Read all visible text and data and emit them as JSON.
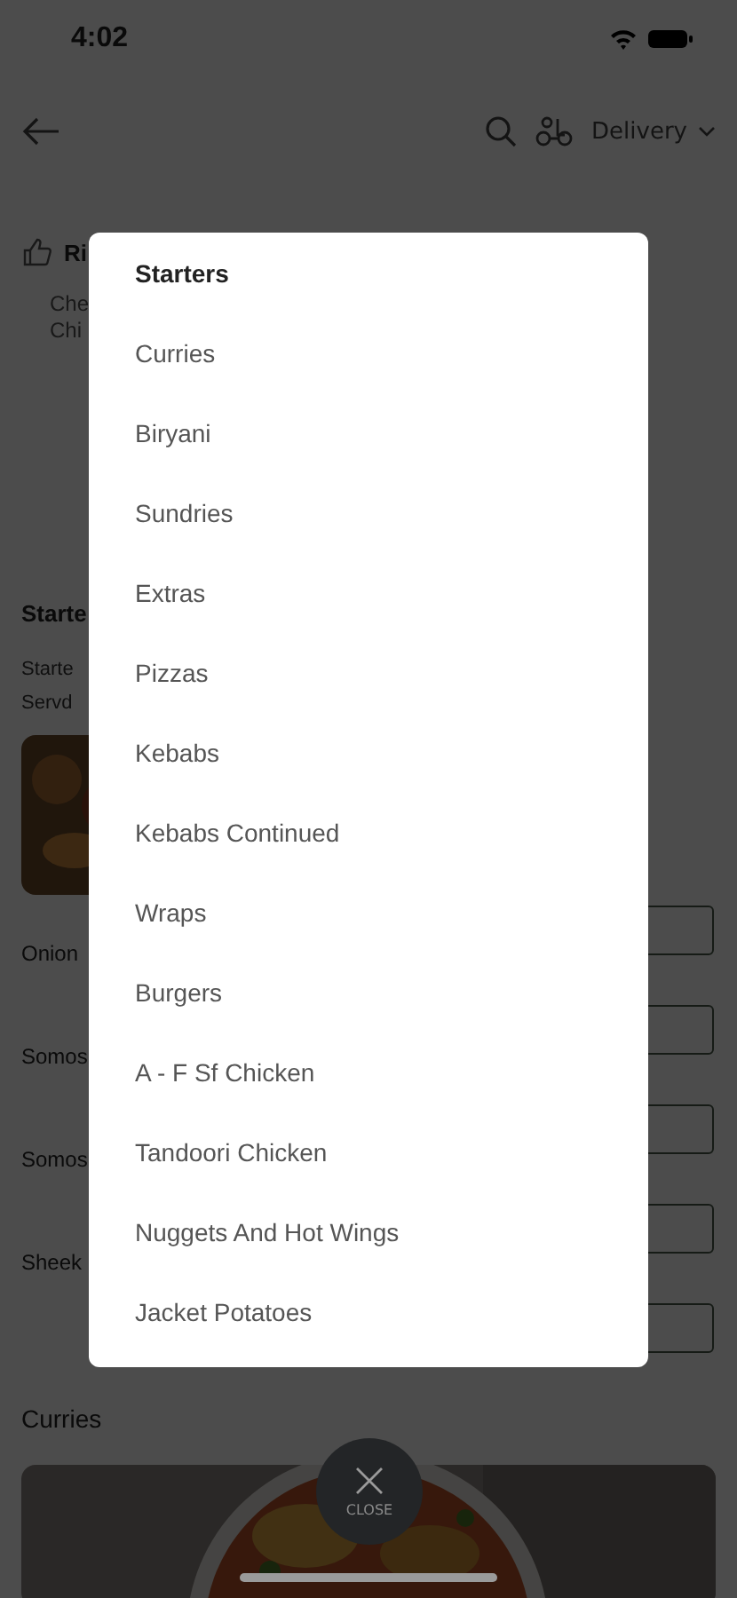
{
  "status_bar": {
    "time": "4:02"
  },
  "header": {
    "delivery_label": "Delivery"
  },
  "background": {
    "rating_fragment": "Ri",
    "description_fragments": [
      "Che",
      "Chi"
    ],
    "section_heading": "Starte",
    "section_subtitle_fragments": [
      "Starte",
      "Servd"
    ],
    "rows": [
      "Onion",
      "Somos",
      "Somos",
      "Sheek"
    ],
    "next_heading": "Curries"
  },
  "menu": {
    "items": [
      {
        "label": "Starters",
        "selected": true
      },
      {
        "label": "Curries",
        "selected": false
      },
      {
        "label": "Biryani",
        "selected": false
      },
      {
        "label": "Sundries",
        "selected": false
      },
      {
        "label": "Extras",
        "selected": false
      },
      {
        "label": "Pizzas",
        "selected": false
      },
      {
        "label": "Kebabs",
        "selected": false
      },
      {
        "label": "Kebabs Continued",
        "selected": false
      },
      {
        "label": "Wraps",
        "selected": false
      },
      {
        "label": "Burgers",
        "selected": false
      },
      {
        "label": "A - F Sf Chicken",
        "selected": false
      },
      {
        "label": "Tandoori Chicken",
        "selected": false
      },
      {
        "label": "Nuggets And Hot Wings",
        "selected": false
      },
      {
        "label": "Jacket Potatoes",
        "selected": false
      }
    ]
  },
  "close_button": {
    "label": "CLOSE"
  }
}
